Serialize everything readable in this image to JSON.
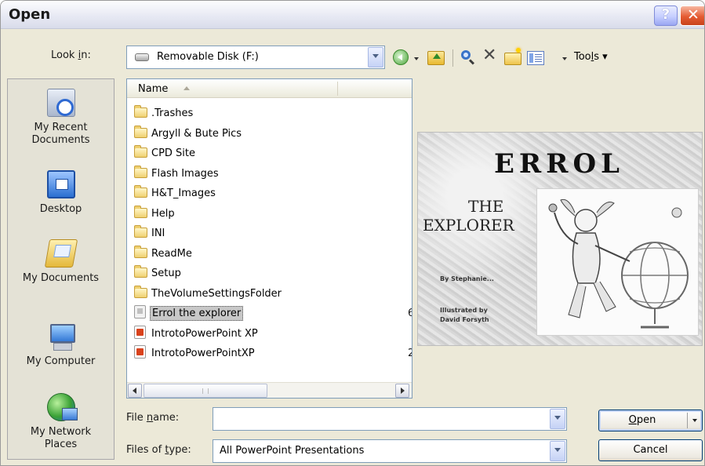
{
  "window": {
    "title": "Open",
    "help_glyph": "?",
    "close_glyph": "✕"
  },
  "lookin": {
    "label": "Look in:",
    "value": "Removable Disk (F:)"
  },
  "toolbar": {
    "tools_label": "Tools ▾",
    "delete_glyph": "✕"
  },
  "places": [
    {
      "label": "My Recent Documents",
      "icon": "recent-documents-icon"
    },
    {
      "label": "Desktop",
      "icon": "desktop-icon"
    },
    {
      "label": "My Documents",
      "icon": "my-documents-icon"
    },
    {
      "label": "My Computer",
      "icon": "my-computer-icon"
    },
    {
      "label": "My Network Places",
      "icon": "network-places-icon"
    }
  ],
  "filelist": {
    "column_name": "Name",
    "items": [
      {
        "name": ".Trashes",
        "type": "folder",
        "size": ""
      },
      {
        "name": "Argyll & Bute Pics",
        "type": "folder",
        "size": ""
      },
      {
        "name": "CPD Site",
        "type": "folder",
        "size": ""
      },
      {
        "name": "Flash Images",
        "type": "folder",
        "size": ""
      },
      {
        "name": "H&T_Images",
        "type": "folder",
        "size": ""
      },
      {
        "name": "Help",
        "type": "folder",
        "size": ""
      },
      {
        "name": "INI",
        "type": "folder",
        "size": ""
      },
      {
        "name": "ReadMe",
        "type": "folder",
        "size": ""
      },
      {
        "name": "Setup",
        "type": "folder",
        "size": ""
      },
      {
        "name": "TheVolumeSettingsFolder",
        "type": "folder",
        "size": ""
      },
      {
        "name": "Errol the explorer",
        "type": "presentation-gray",
        "size": "6",
        "selected": true
      },
      {
        "name": "IntrotoPowerPoint XP",
        "type": "presentation",
        "size": ""
      },
      {
        "name": "IntrotoPowerPointXP",
        "type": "presentation",
        "size": "2"
      }
    ]
  },
  "preview": {
    "title": "ERROL",
    "line1": "THE",
    "line2": "EXPLORER",
    "small_by": "By Stephanie...",
    "small_ill1": "Illustrated by",
    "small_ill2": "David Forsyth"
  },
  "bottom": {
    "filename_label": "File name:",
    "filename_value": "",
    "filetype_label": "Files of type:",
    "filetype_value": "All PowerPoint Presentations",
    "open_label": "Open",
    "cancel_label": "Cancel"
  }
}
